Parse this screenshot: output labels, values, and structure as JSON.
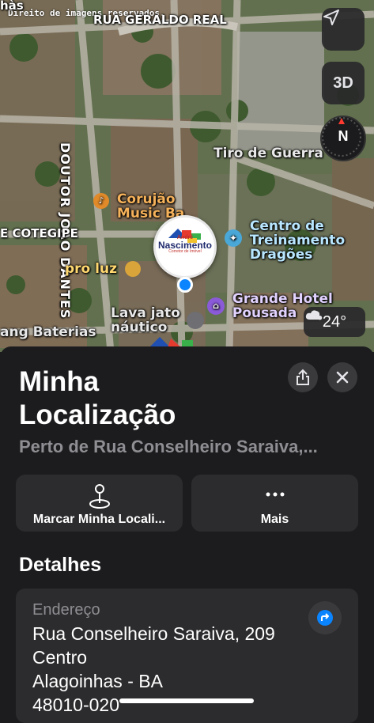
{
  "map": {
    "copyright": "Direito de imagens reservados.",
    "streets": {
      "top_left": "hàs",
      "geraldo_rego": "RUA GERALDO REAL",
      "doutor_joao_dantes": "DOUTOR JOÃO DANTES",
      "cotegipe": "E COTEGIPE"
    },
    "pois": {
      "tiro_de_guerra": "Tiro de Guerra",
      "corujao_1": "Corujão",
      "corujao_2": "Music Ba",
      "centro_1": "Centro de",
      "centro_2": "Treinamento",
      "centro_3": "Dragões",
      "pro_luz": "pro luz",
      "lava_jato_1": "Lava jato",
      "lava_jato_2": "náutico",
      "grande_hotel_1": "Grande Hotel",
      "grande_hotel_2": "Pousada",
      "baterias": "ang Baterias"
    },
    "pin_brand": {
      "line1": "André",
      "line2": "Nascimento",
      "line3": "Corretor de Imóvel"
    },
    "controls": {
      "threed_label": "3D",
      "compass_label": "N",
      "weather_temp": "24°"
    },
    "icons": {
      "location": "location-arrow-icon",
      "weather": "partly-cloudy-night-icon"
    }
  },
  "sheet": {
    "title_line1": "Minha",
    "title_line2": "Localização",
    "subtitle": "Perto de Rua Conselheiro Saraiva,...",
    "actions": [
      {
        "label": "Marcar Minha Locali...",
        "icon": "map-pin-icon"
      },
      {
        "label": "Mais",
        "icon": "more-icon"
      }
    ],
    "details_heading": "Detalhes",
    "address": {
      "label": "Endereço",
      "line1": "Rua Conselheiro Saraiva, 209",
      "line2": "Centro",
      "line3": "Alagoinhas - BA",
      "line4": "48010-020"
    }
  },
  "colors": {
    "accent_blue": "#0a84ff",
    "sheet_bg": "#1c1c1e",
    "card_bg": "#2c2c2e"
  }
}
